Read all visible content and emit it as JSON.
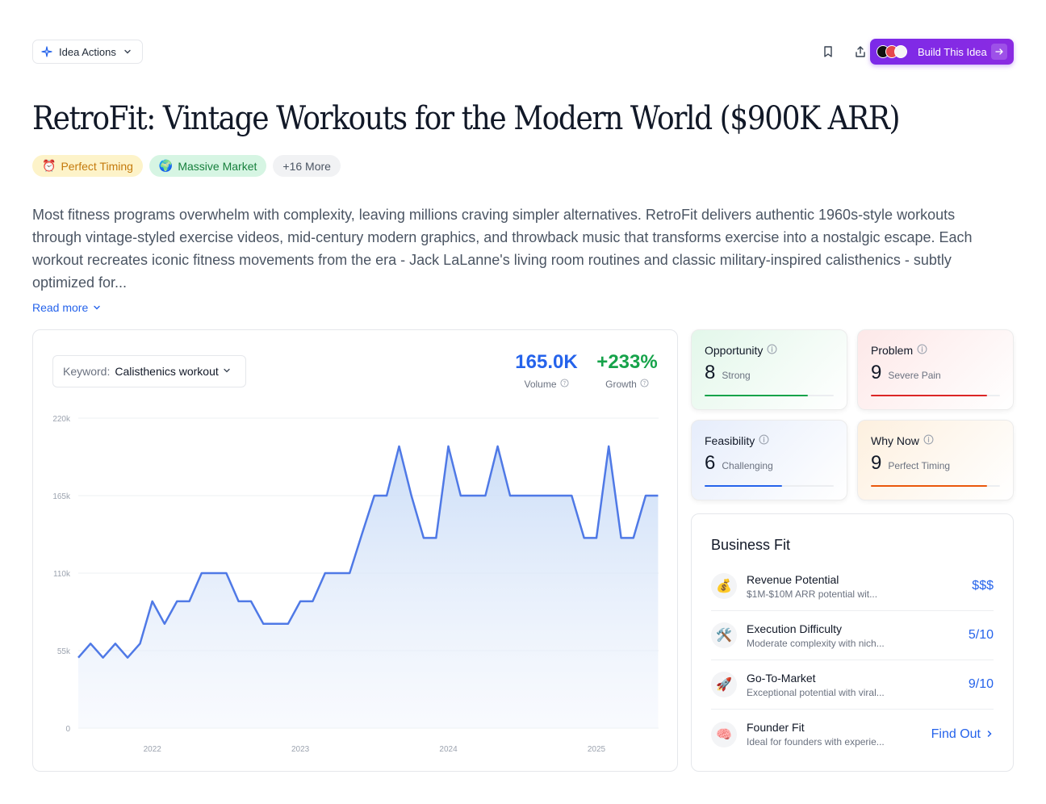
{
  "header": {
    "idea_actions_label": "Idea Actions",
    "build_label": "Build This Idea"
  },
  "title": "RetroFit: Vintage Workouts for the Modern World ($900K ARR)",
  "tags": [
    {
      "emoji": "⏰",
      "label": "Perfect Timing"
    },
    {
      "emoji": "🌍",
      "label": "Massive Market"
    },
    {
      "label": "+16 More"
    }
  ],
  "description": "Most fitness programs overwhelm with complexity, leaving millions craving simpler alternatives. RetroFit delivers authentic 1960s-style workouts through vintage-styled exercise videos, mid-century modern graphics, and throwback music that transforms exercise into a nostalgic escape. Each workout recreates iconic fitness movements from the era - Jack LaLanne's living room routines and classic military-inspired calisthenics - subtly optimized for...",
  "read_more": "Read more",
  "keyword": {
    "label": "Keyword:",
    "value": "Calisthenics workout"
  },
  "stats": {
    "volume_value": "165.0K",
    "volume_label": "Volume",
    "growth_value": "+233%",
    "growth_label": "Growth"
  },
  "chart_data": {
    "type": "area",
    "y_ticks": [
      "0",
      "55k",
      "110k",
      "165k",
      "220k"
    ],
    "ylim": [
      0,
      220000
    ],
    "x_ticks": [
      {
        "label": "2022",
        "x": 2022.0
      },
      {
        "label": "2023",
        "x": 2023.0
      },
      {
        "label": "2024",
        "x": 2024.0
      },
      {
        "label": "2025",
        "x": 2025.0
      }
    ],
    "xlim": [
      2021.5,
      2025.42
    ],
    "line_color": "#4f79e6",
    "x": [
      2021.5,
      2021.583,
      2021.667,
      2021.75,
      2021.833,
      2021.917,
      2022.0,
      2022.083,
      2022.167,
      2022.25,
      2022.333,
      2022.417,
      2022.5,
      2022.583,
      2022.667,
      2022.75,
      2022.833,
      2022.917,
      2023.0,
      2023.083,
      2023.167,
      2023.25,
      2023.333,
      2023.417,
      2023.5,
      2023.583,
      2023.667,
      2023.75,
      2023.833,
      2023.917,
      2024.0,
      2024.083,
      2024.167,
      2024.25,
      2024.333,
      2024.417,
      2024.5,
      2024.583,
      2024.667,
      2024.75,
      2024.833,
      2024.917,
      2025.0,
      2025.083,
      2025.167,
      2025.25,
      2025.333,
      2025.417
    ],
    "values": [
      50000,
      60000,
      50000,
      60000,
      50000,
      60000,
      90000,
      74000,
      90000,
      90000,
      110000,
      110000,
      110000,
      90000,
      90000,
      74000,
      74000,
      74000,
      90000,
      90000,
      110000,
      110000,
      110000,
      138000,
      165000,
      165000,
      200000,
      165000,
      135000,
      135000,
      200000,
      165000,
      165000,
      165000,
      200000,
      165000,
      165000,
      165000,
      165000,
      165000,
      165000,
      135000,
      135000,
      200000,
      135000,
      135000,
      165000,
      165000
    ]
  },
  "metrics": [
    {
      "title": "Opportunity",
      "score": "8",
      "desc": "Strong",
      "fraction": 0.8,
      "color": "#16a34a"
    },
    {
      "title": "Problem",
      "score": "9",
      "desc": "Severe Pain",
      "fraction": 0.9,
      "color": "#dc2626"
    },
    {
      "title": "Feasibility",
      "score": "6",
      "desc": "Challenging",
      "fraction": 0.6,
      "color": "#2563eb"
    },
    {
      "title": "Why Now",
      "score": "9",
      "desc": "Perfect Timing",
      "fraction": 0.9,
      "color": "#ea580c"
    }
  ],
  "business_fit": {
    "title": "Business Fit",
    "items": [
      {
        "icon": "💰",
        "name": "Revenue Potential",
        "sub": "$1M-$10M ARR potential wit...",
        "value": "$$$"
      },
      {
        "icon": "🛠️",
        "name": "Execution Difficulty",
        "sub": "Moderate complexity with nich...",
        "value": "5/10"
      },
      {
        "icon": "🚀",
        "name": "Go-To-Market",
        "sub": "Exceptional potential with viral...",
        "value": "9/10"
      },
      {
        "icon": "🧠",
        "name": "Founder Fit",
        "sub": "Ideal for founders with experie...",
        "value": "Find Out"
      }
    ]
  }
}
